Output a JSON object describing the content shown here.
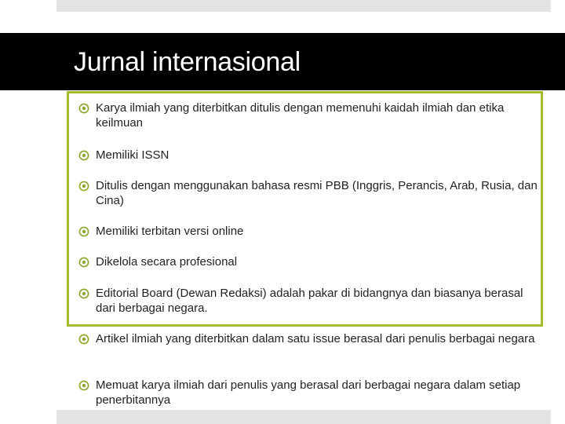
{
  "title": "Jurnal internasional",
  "bullet_icon": "target-circle-icon",
  "colors": {
    "title_band": "#000000",
    "title_text": "#ffffff",
    "highlight_border": "#a3bc2e",
    "bullet": "#8aa62a",
    "body_text": "#222222",
    "bars": "#e3e3e3"
  },
  "items": [
    {
      "text": "Karya ilmiah yang diterbitkan ditulis dengan memenuhi kaidah ilmiah dan etika keilmuan"
    },
    {
      "text": "Memiliki ISSN"
    },
    {
      "text": "Ditulis dengan menggunakan bahasa resmi PBB (Inggris, Perancis, Arab, Rusia, dan Cina)"
    },
    {
      "text": "Memiliki terbitan versi online"
    },
    {
      "text": "Dikelola secara profesional"
    },
    {
      "text": "Editorial Board (Dewan Redaksi) adalah pakar di bidangnya dan biasanya berasal dari berbagai negara."
    },
    {
      "text": "Artikel ilmiah yang diterbitkan dalam satu issue berasal dari penulis berbagai negara"
    },
    {
      "text": "Memuat karya ilmiah dari penulis yang berasal dari berbagai negara dalam setiap penerbitannya"
    }
  ]
}
